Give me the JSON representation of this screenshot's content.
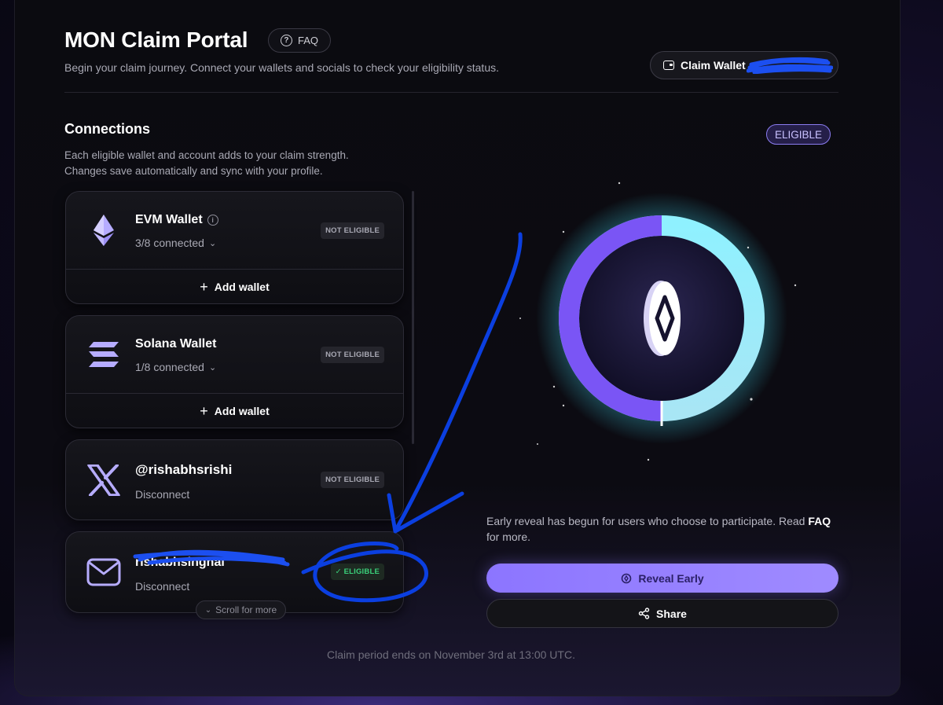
{
  "header": {
    "title": "MON Claim Portal",
    "faq_label": "FAQ",
    "subtitle": "Begin your claim journey. Connect your wallets and socials to check your eligibility status.",
    "claim_wallet_label": "Claim Wallet"
  },
  "connections": {
    "title": "Connections",
    "description_line1": "Each eligible wallet and account adds to your claim strength.",
    "description_line2": "Changes save automatically and sync with your profile.",
    "overall_status": "ELIGIBLE",
    "scroll_hint": "Scroll for more",
    "items": [
      {
        "name": "EVM Wallet",
        "sub": "3/8 connected",
        "status": "NOT ELIGIBLE",
        "action": "Add wallet",
        "icon": "ethereum-icon"
      },
      {
        "name": "Solana Wallet",
        "sub": "1/8 connected",
        "status": "NOT ELIGIBLE",
        "action": "Add wallet",
        "icon": "solana-icon"
      },
      {
        "name": "@rishabhsrishi",
        "sub": "Disconnect",
        "status": "NOT ELIGIBLE",
        "icon": "x-logo-icon"
      },
      {
        "name": "rishabhsinghal",
        "sub": "Disconnect",
        "status": "ELIGIBLE",
        "icon": "mail-icon"
      }
    ]
  },
  "reveal": {
    "text_before": "Early reveal has begun for users who choose to participate. Read ",
    "faq_link": "FAQ",
    "text_after": " for more.",
    "reveal_button": "Reveal Early",
    "share_button": "Share",
    "progress_fraction": 0.5
  },
  "footer": {
    "text": "Claim period ends on November 3rd at 13:00 UTC."
  },
  "colors": {
    "accent": "#8c75ff",
    "ring": "#7ee6f5",
    "eligible_green": "#3ad07a",
    "annotation_blue": "#0b3fe0"
  }
}
